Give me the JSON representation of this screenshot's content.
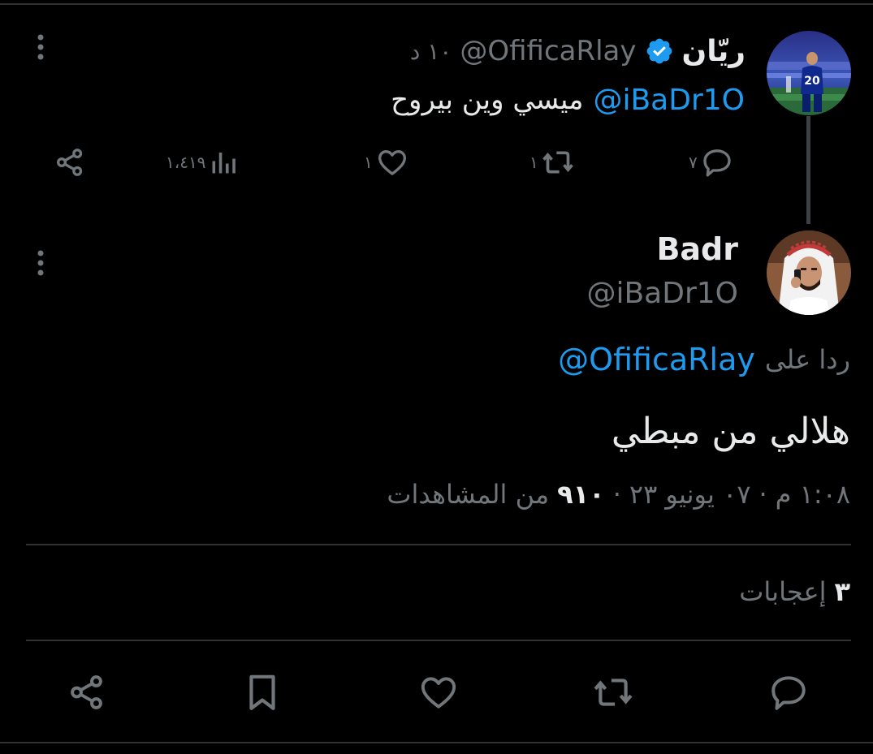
{
  "parent_tweet": {
    "name": "ريّان",
    "verified": true,
    "handle": "@OfificaRlay",
    "time_ago": "١٠ د",
    "mention": "@iBaDr1O",
    "text": "ميسي وين بيروح",
    "actions": {
      "reply_count": "٧",
      "retweet_count": "١",
      "like_count": "١",
      "views_count": "١،٤١٩"
    },
    "avatar": "player-number-20-photo"
  },
  "main_tweet": {
    "name": "Badr",
    "handle": "@iBaDr1O",
    "avatar": "man-in-shemagh-on-phone-photo",
    "reply_prefix": "ردا على",
    "reply_to": "@OfificaRlay",
    "text": "هلالي من مبطي",
    "time": "١:٠٨ م",
    "date": "٠٧ يونيو ٢٣",
    "views_count": "٩١٠",
    "views_label": "من المشاهدات",
    "likes_count": "٣",
    "likes_label": "إعجابات"
  },
  "colors": {
    "background": "#000000",
    "text": "#e7e9ea",
    "muted": "#71767b",
    "accent": "#1d9bf0",
    "divider": "#2f3336"
  },
  "icons": [
    "more-icon",
    "reply-icon",
    "retweet-icon",
    "like-icon",
    "views-icon",
    "share-icon",
    "bookmark-icon",
    "verified-badge-icon"
  ]
}
